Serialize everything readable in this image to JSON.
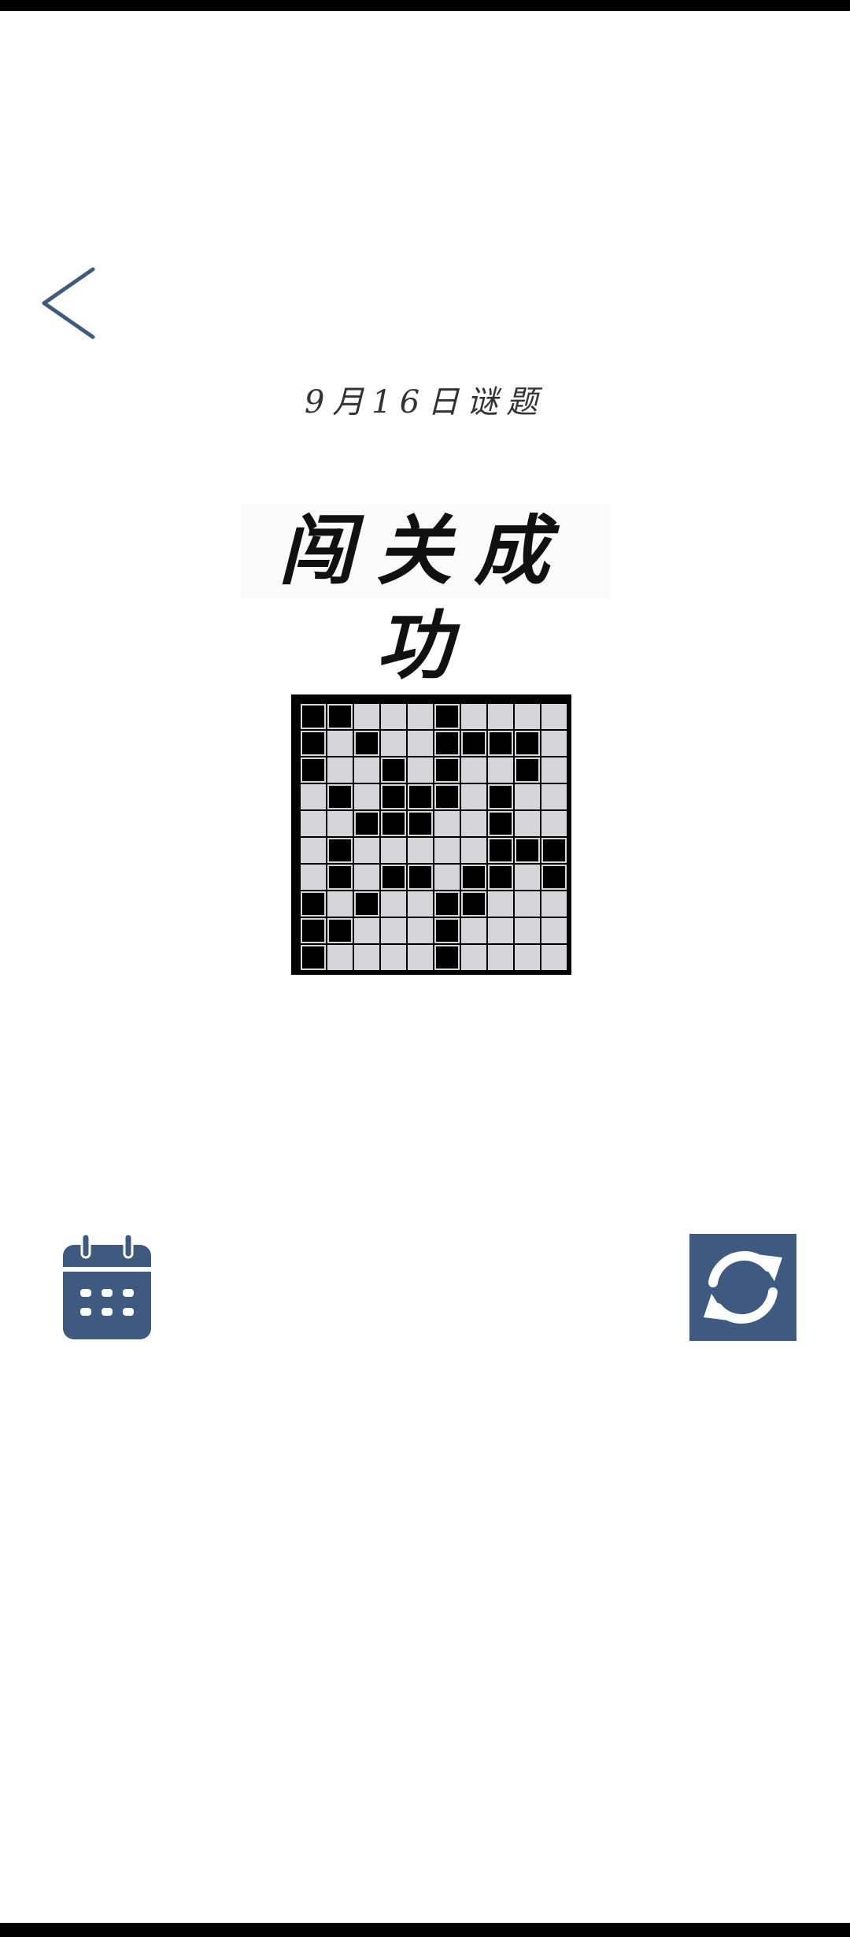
{
  "header": {
    "puzzle_date": "9月16日谜题",
    "back_icon": "chevron-left-icon"
  },
  "result": {
    "title": "闯关成功"
  },
  "board": {
    "rows": 10,
    "cols": 10,
    "filled": [
      [
        1,
        1,
        0,
        0,
        0,
        1,
        0,
        0,
        0,
        0
      ],
      [
        1,
        0,
        1,
        0,
        0,
        1,
        1,
        1,
        1,
        0
      ],
      [
        1,
        0,
        0,
        1,
        0,
        1,
        0,
        0,
        1,
        0
      ],
      [
        0,
        1,
        0,
        1,
        1,
        1,
        0,
        1,
        0,
        0
      ],
      [
        0,
        0,
        1,
        1,
        1,
        0,
        0,
        1,
        0,
        0
      ],
      [
        0,
        1,
        0,
        0,
        0,
        0,
        0,
        1,
        1,
        1
      ],
      [
        0,
        1,
        0,
        1,
        1,
        0,
        1,
        1,
        0,
        1
      ],
      [
        1,
        0,
        1,
        0,
        0,
        1,
        1,
        0,
        0,
        0
      ],
      [
        1,
        1,
        0,
        0,
        0,
        1,
        0,
        0,
        0,
        0
      ],
      [
        1,
        0,
        0,
        0,
        0,
        1,
        0,
        0,
        0,
        0
      ]
    ]
  },
  "footer": {
    "calendar_icon": "calendar-icon",
    "refresh_icon": "refresh-icon"
  },
  "colors": {
    "accent": "#3e5a80",
    "cell_empty": "#d6d6d8",
    "cell_filled": "#000000"
  }
}
